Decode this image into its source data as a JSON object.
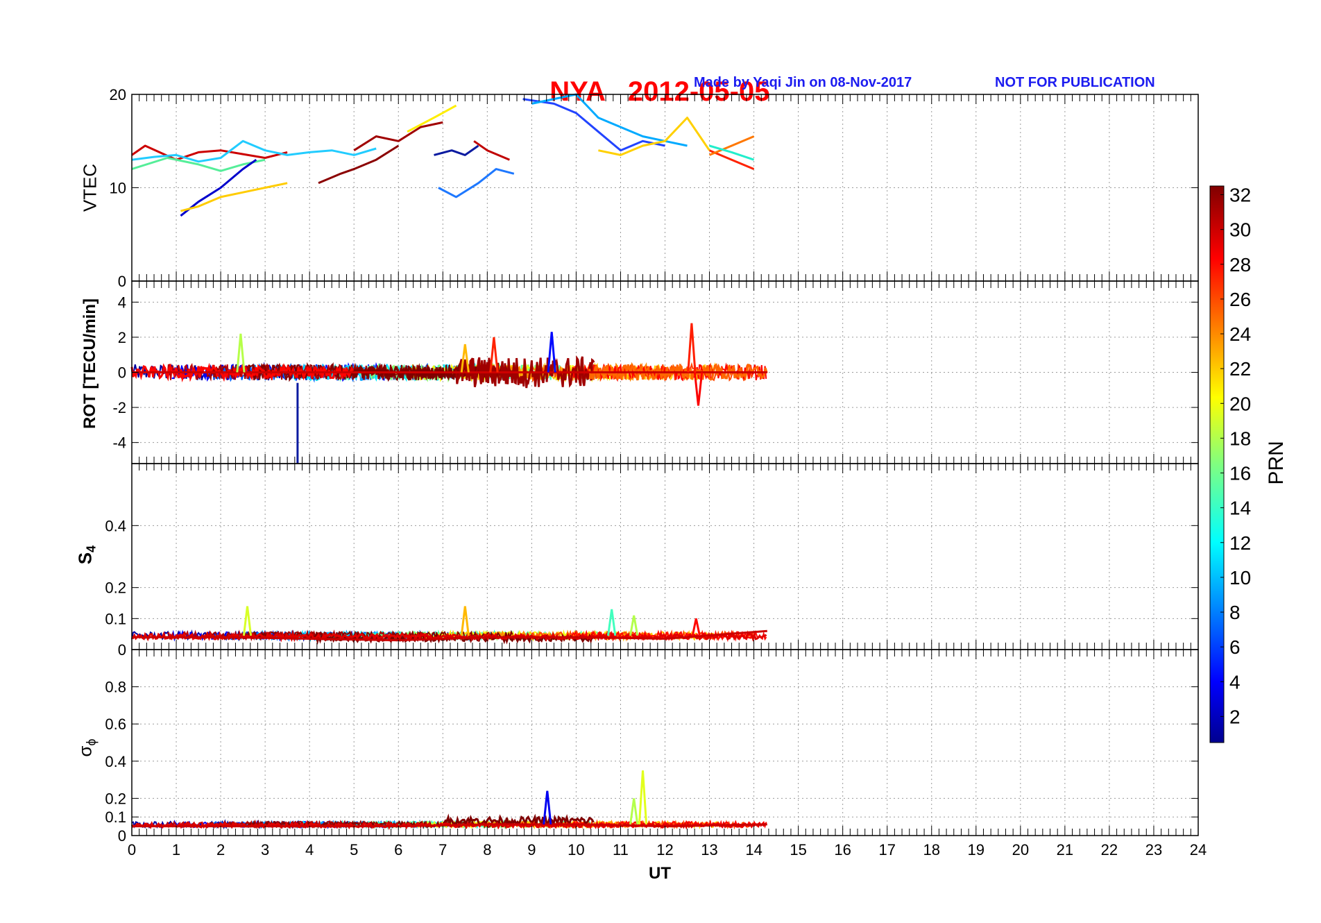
{
  "header": {
    "station": "NYA",
    "date": "2012-05-05",
    "credit": "Made by Yaqi Jin on 08-Nov-2017",
    "notice": "NOT FOR PUBLICATION"
  },
  "xaxis": {
    "label": "UT",
    "ticks": [
      "0",
      "1",
      "2",
      "3",
      "4",
      "5",
      "6",
      "7",
      "8",
      "9",
      "10",
      "11",
      "12",
      "13",
      "14",
      "15",
      "16",
      "17",
      "18",
      "19",
      "20",
      "21",
      "22",
      "23",
      "24"
    ]
  },
  "colorbar": {
    "label": "PRN",
    "ticks": [
      "2",
      "4",
      "6",
      "8",
      "10",
      "12",
      "14",
      "16",
      "18",
      "20",
      "22",
      "24",
      "26",
      "28",
      "30",
      "32"
    ],
    "colormap": "jet",
    "range": [
      1,
      32
    ]
  },
  "panels": {
    "vtec": {
      "label": "VTEC",
      "ticks": [
        "0",
        "10",
        "20"
      ]
    },
    "rot": {
      "label": "ROT [TECU/min]",
      "ticks": [
        "-4",
        "-2",
        "0",
        "2",
        "4"
      ]
    },
    "s4": {
      "label_main": "S",
      "label_sub": "4",
      "ticks": [
        "0",
        "0.1",
        "0.2",
        "0.4"
      ]
    },
    "sigma": {
      "label_main": "σ",
      "label_sub": "ϕ",
      "ticks": [
        "0",
        "0.1",
        "0.2",
        "0.4",
        "0.6",
        "0.8"
      ]
    }
  },
  "chart_data": [
    {
      "type": "line",
      "panel": "VTEC",
      "xlabel": "UT",
      "ylabel": "VTEC",
      "xlim": [
        0,
        24
      ],
      "ylim": [
        0,
        20
      ],
      "grid": true,
      "series": [
        {
          "prn": 30,
          "color": "#cc0000",
          "x": [
            0,
            0.3,
            1.0,
            1.5,
            2.0,
            2.5,
            3.0,
            3.5
          ],
          "y": [
            13.5,
            14.5,
            13.0,
            13.8,
            14.0,
            13.6,
            13.2,
            13.8
          ]
        },
        {
          "prn": 12,
          "color": "#22ccff",
          "x": [
            0,
            0.5,
            1.0,
            1.5,
            2.0,
            2.5,
            3.0,
            3.5,
            4.0,
            4.5,
            5.0,
            5.5
          ],
          "y": [
            13.0,
            13.3,
            13.5,
            12.8,
            13.2,
            15.0,
            14.0,
            13.5,
            13.8,
            14.0,
            13.5,
            14.2
          ]
        },
        {
          "prn": 16,
          "color": "#55ee99",
          "x": [
            0,
            0.8,
            1.5,
            2.0,
            2.5,
            3.0
          ],
          "y": [
            12.0,
            13.2,
            12.5,
            11.8,
            12.5,
            13.0
          ]
        },
        {
          "prn": 2,
          "color": "#0000cc",
          "x": [
            1.1,
            1.5,
            2.0,
            2.5,
            2.8
          ],
          "y": [
            7.0,
            8.5,
            10.0,
            12.0,
            13.0
          ]
        },
        {
          "prn": 22,
          "color": "#ffcc00",
          "x": [
            1.1,
            1.5,
            2.0,
            2.5,
            3.0,
            3.5
          ],
          "y": [
            7.5,
            8.0,
            9.0,
            9.5,
            10.0,
            10.5
          ]
        },
        {
          "prn": 32,
          "color": "#8b0000",
          "x": [
            4.2,
            4.7,
            5.0,
            5.5,
            6.0
          ],
          "y": [
            10.5,
            11.5,
            12.0,
            13.0,
            14.5
          ]
        },
        {
          "prn": 31,
          "color": "#a00000",
          "x": [
            5.0,
            5.5,
            6.0,
            6.5,
            7.0
          ],
          "y": [
            14.0,
            15.5,
            15.0,
            16.5,
            17.0
          ]
        },
        {
          "prn": 20,
          "color": "#ffee00",
          "x": [
            6.2,
            6.8,
            7.3
          ],
          "y": [
            16.0,
            17.5,
            18.8
          ]
        },
        {
          "prn": 3,
          "color": "#0a1aa0",
          "x": [
            6.8,
            7.2,
            7.5,
            7.8
          ],
          "y": [
            13.5,
            14.0,
            13.5,
            14.5
          ]
        },
        {
          "prn": 10,
          "color": "#1e78ff",
          "x": [
            6.9,
            7.3,
            7.8,
            8.2,
            8.6
          ],
          "y": [
            10.0,
            9.0,
            10.5,
            12.0,
            11.5
          ]
        },
        {
          "prn": 29,
          "color": "#c00000",
          "x": [
            7.7,
            8.0,
            8.5
          ],
          "y": [
            15.0,
            14.0,
            13.0
          ]
        },
        {
          "prn": 6,
          "color": "#2244ff",
          "x": [
            8.8,
            9.5,
            10.0,
            10.5,
            11.0,
            11.5,
            12.0
          ],
          "y": [
            19.5,
            19.0,
            18.0,
            16.0,
            14.0,
            15.0,
            14.5
          ]
        },
        {
          "prn": 11,
          "color": "#00aaff",
          "x": [
            9.0,
            10.0,
            10.5,
            11.0,
            11.5,
            12.0,
            12.5
          ],
          "y": [
            19.0,
            20.0,
            17.5,
            16.5,
            15.5,
            15.0,
            14.5
          ]
        },
        {
          "prn": 23,
          "color": "#ffd000",
          "x": [
            10.5,
            11.0,
            11.5,
            12.0,
            12.5,
            13.0
          ],
          "y": [
            14.0,
            13.5,
            14.5,
            15.0,
            17.5,
            14.0
          ]
        },
        {
          "prn": 27,
          "color": "#ff2200",
          "x": [
            13.0,
            13.5,
            14.0
          ],
          "y": [
            14.0,
            13.0,
            12.0
          ]
        },
        {
          "prn": 25,
          "color": "#ff7700",
          "x": [
            13.0,
            13.5,
            14.0
          ],
          "y": [
            13.5,
            14.5,
            15.5
          ]
        },
        {
          "prn": 14,
          "color": "#22eecc",
          "x": [
            13.0,
            13.5,
            14.0
          ],
          "y": [
            14.5,
            13.8,
            13.0
          ]
        }
      ]
    },
    {
      "type": "line",
      "panel": "ROT",
      "xlabel": "UT",
      "ylabel": "ROT [TECU/min]",
      "xlim": [
        0,
        24
      ],
      "ylim": [
        -5.2,
        5.2
      ],
      "grid": true,
      "series": [
        {
          "prn": 30,
          "color": "#cc0000",
          "x": [
            0,
            2,
            4,
            6,
            8,
            10,
            12,
            14.3
          ],
          "y": [
            0,
            0,
            0,
            0,
            0,
            0,
            0,
            0
          ]
        },
        {
          "prn": 3,
          "color": "#0a1aa0",
          "x": [
            3.73,
            3.73
          ],
          "y": [
            -0.6,
            -5.2
          ]
        }
      ],
      "notable_peaks": [
        {
          "x": 2.45,
          "y": 2.2
        },
        {
          "x": 7.5,
          "y": 1.6
        },
        {
          "x": 8.15,
          "y": 2.0
        },
        {
          "x": 9.45,
          "y": 2.3
        },
        {
          "x": 12.6,
          "y": 2.8
        },
        {
          "x": 12.75,
          "y": -1.9
        }
      ]
    },
    {
      "type": "line",
      "panel": "S4",
      "xlabel": "UT",
      "ylabel": "S4",
      "xlim": [
        0,
        24
      ],
      "ylim": [
        0,
        0.6
      ],
      "grid": true,
      "series": [
        {
          "prn": 30,
          "color": "#cc0000",
          "x": [
            0,
            2,
            4,
            6,
            8,
            10,
            12,
            14.3
          ],
          "y": [
            0.04,
            0.04,
            0.035,
            0.03,
            0.04,
            0.04,
            0.035,
            0.06
          ]
        }
      ],
      "notable_peaks": [
        {
          "x": 2.6,
          "y": 0.14
        },
        {
          "x": 7.5,
          "y": 0.14
        },
        {
          "x": 10.8,
          "y": 0.13
        },
        {
          "x": 11.3,
          "y": 0.11
        },
        {
          "x": 12.7,
          "y": 0.1
        }
      ]
    },
    {
      "type": "line",
      "panel": "sigma_phi",
      "xlabel": "UT",
      "ylabel": "σϕ",
      "xlim": [
        0,
        24
      ],
      "ylim": [
        0,
        1
      ],
      "grid": true,
      "series": [
        {
          "prn": 30,
          "color": "#cc0000",
          "x": [
            0,
            2,
            4,
            6,
            8,
            10,
            12,
            14.3
          ],
          "y": [
            0.05,
            0.05,
            0.05,
            0.05,
            0.06,
            0.06,
            0.05,
            0.06
          ]
        }
      ],
      "notable_peaks": [
        {
          "x": 9.35,
          "y": 0.24
        },
        {
          "x": 11.3,
          "y": 0.2
        },
        {
          "x": 11.5,
          "y": 0.35
        }
      ]
    }
  ]
}
